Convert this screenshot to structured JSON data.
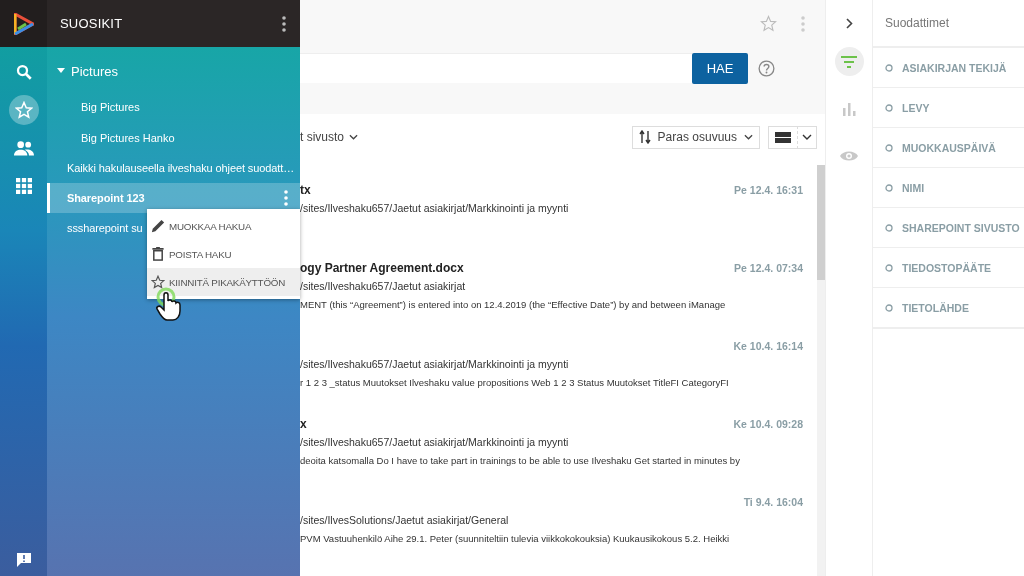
{
  "rail": {
    "items": [
      {
        "kind": "search",
        "selected": false
      },
      {
        "kind": "favorites",
        "selected": true
      },
      {
        "kind": "people",
        "selected": false
      },
      {
        "kind": "apps",
        "selected": false
      }
    ]
  },
  "favorites": {
    "title": "SUOSIKIT",
    "items": [
      {
        "label": "Pictures",
        "selected": false,
        "expanded": true,
        "children": [
          {
            "label": "Big Pictures",
            "selected": false
          },
          {
            "label": "Big Pictures Hanko",
            "selected": false
          }
        ]
      },
      {
        "label": "Kaikki hakulauseella ilveshaku ohjeet suodatt…",
        "selected": false
      },
      {
        "label": "Sharepoint 123",
        "selected": true
      },
      {
        "label": "sssharepoint su",
        "selected": false
      }
    ]
  },
  "context_menu": {
    "items": [
      {
        "kind": "edit",
        "label": "MUOKKAA HAKUA",
        "highlighted": false
      },
      {
        "kind": "delete",
        "label": "POISTA HAKU",
        "highlighted": false
      },
      {
        "kind": "pin",
        "label": "KIINNITÄ PIKAKÄYTTÖÖN",
        "highlighted": true
      }
    ]
  },
  "search": {
    "button": "HAE"
  },
  "toolbar": {
    "site_filter": "t sivusto",
    "sort": "Paras osuvuus",
    "list_view": {
      "selected": true
    }
  },
  "results": [
    {
      "title": "tx",
      "date": "Pe 12.4. 16:31",
      "path": "/sites/Ilveshaku657/Jaetut asiakirjat/Markkinointi ja myynti"
    },
    {
      "title": "ogy Partner Agreement.docx",
      "date": "Pe 12.4. 07:34",
      "path": "/sites/Ilveshaku657/Jaetut asiakirjat",
      "snippet": "MENT (this “Agreement”) is entered into on 12.4.2019 (the “Effective Date”) by and between iManage"
    },
    {
      "date": "Ke 10.4. 16:14",
      "path": "/sites/Ilveshaku657/Jaetut asiakirjat/Markkinointi ja myynti",
      "snippet": "r 1 2 3 _status Muutokset Ilveshaku value propositions Web 1 2 3 Status Muutokset TitleFI CategoryFI"
    },
    {
      "title": "x",
      "date": "Ke 10.4. 09:28",
      "path": "/sites/Ilveshaku657/Jaetut asiakirjat/Markkinointi ja myynti",
      "snippet": "deoita katsomalla Do I have to take part in trainings to be able to use Ilveshaku Get started in minutes by"
    },
    {
      "date": "Ti 9.4. 16:04",
      "path": "/sites/IlvesSolutions/Jaetut asiakirjat/General",
      "snippet": "PVM Vastuuhenkilö Aihe 29.1. Peter (suunniteltiin tulevia viikkokokouksia) Kuukausikokous 5.2. Heikki"
    }
  ],
  "filter_rail": {
    "items": [
      {
        "kind": "filters",
        "selected": true
      },
      {
        "kind": "stats",
        "selected": false
      },
      {
        "kind": "preview",
        "selected": false
      }
    ]
  },
  "filters": {
    "title": "Suodattimet",
    "items": [
      "ASIAKIRJAN TEKIJÄ",
      "LEVY",
      "MUOKKAUSPÄIVÄ",
      "NIMI",
      "SHAREPOINT SIVUSTO",
      "TIEDOSTOPÄÄTE",
      "TIETOLÄHDE"
    ]
  }
}
